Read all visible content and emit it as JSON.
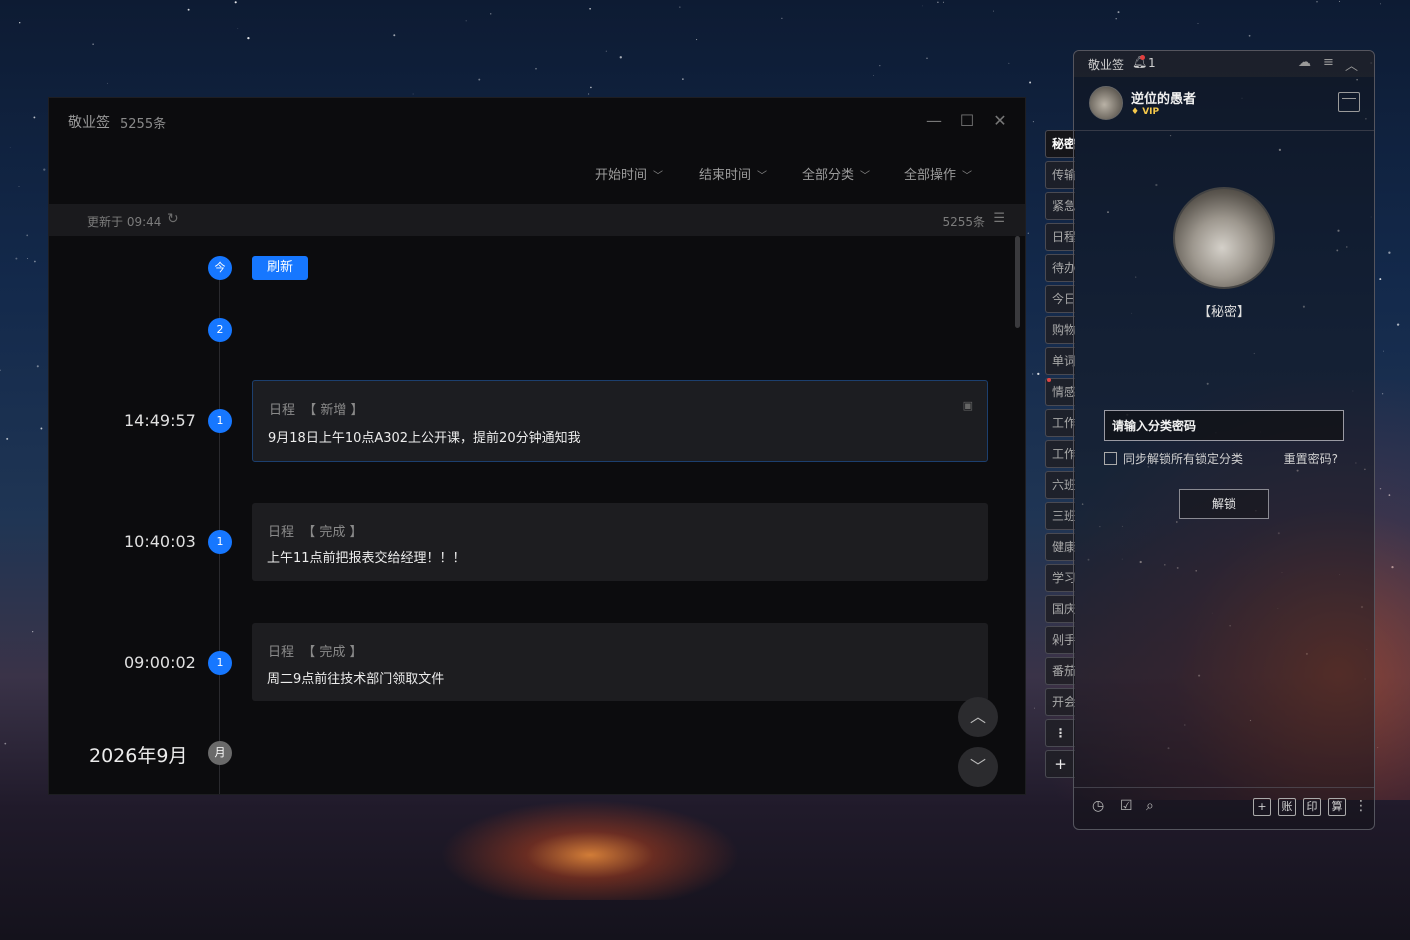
{
  "main_window": {
    "app_name": "敬业签",
    "count_label": "5255条",
    "controls": {
      "minimize": "—",
      "maximize": "☐",
      "close": "✕"
    },
    "filters": [
      "开始时间",
      "结束时间",
      "全部分类",
      "全部操作"
    ],
    "status": {
      "updated": "更新于 09:44",
      "total": "5255条"
    },
    "timeline": {
      "today_badge": "今",
      "refresh_label": "刷新",
      "group_count": "2",
      "entries": [
        {
          "time": "14:49:57",
          "count": "1",
          "category": "日程",
          "tag": "【 新增 】",
          "text": "9月18日上午10点A302上公开课，提前20分钟通知我"
        },
        {
          "time": "10:40:03",
          "count": "1",
          "category": "日程",
          "tag": "【 完成 】",
          "text": "上午11点前把报表交给经理！！！"
        },
        {
          "time": "09:00:02",
          "count": "1",
          "category": "日程",
          "tag": "【 完成 】",
          "text": "周二9点前往技术部门领取文件"
        }
      ],
      "month_label": "2026年9月",
      "month_badge": "月"
    }
  },
  "side_tabs": [
    "秘密",
    "传输",
    "紧急",
    "日程",
    "待办",
    "今日",
    "购物",
    "单词",
    "情感",
    "工作",
    "工作",
    "六班",
    "三班",
    "健康",
    "学习",
    "国庆",
    "剁手",
    "番茄",
    "开会"
  ],
  "panel": {
    "title": "敬业签",
    "notify_count": "1",
    "user": {
      "name": "逆位的愚者",
      "vip": "VIP"
    },
    "lock": {
      "label": "【秘密】",
      "password_placeholder": "请输入分类密码",
      "sync_label": "同步解锁所有锁定分类",
      "reset_label": "重置密码?",
      "unlock_label": "解锁"
    },
    "footer_buttons": [
      "账",
      "印",
      "算"
    ]
  }
}
